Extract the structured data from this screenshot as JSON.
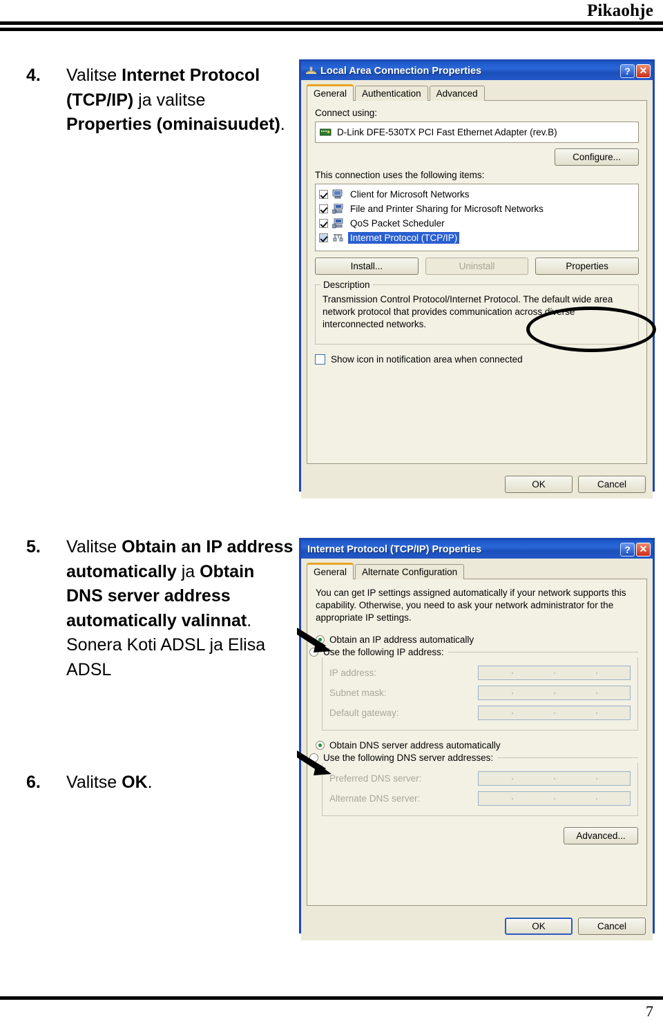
{
  "page": {
    "header_title": "Pikaohje",
    "page_number": "7"
  },
  "steps": [
    {
      "number": "4.",
      "parts": [
        {
          "text": "Valitse ",
          "bold": false
        },
        {
          "text": "Internet Protocol (TCP/IP)",
          "bold": true
        },
        {
          "text": " ja valitse ",
          "bold": false
        },
        {
          "text": "Properties (ominaisuudet)",
          "bold": true
        },
        {
          "text": ".",
          "bold": false
        }
      ],
      "plain": "Valitse Internet Protocol (TCP/IP) ja valitse Properties (ominaisuudet)."
    },
    {
      "number": "5.",
      "parts": [
        {
          "text": "Valitse ",
          "bold": false
        },
        {
          "text": "Obtain an IP address automatically",
          "bold": true
        },
        {
          "text": " ja ",
          "bold": false
        },
        {
          "text": "Obtain DNS server address automatically valinnat",
          "bold": true
        },
        {
          "text": ".",
          "bold": false
        }
      ],
      "note": "Sonera Koti ADSL ja Elisa ADSL",
      "plain": "Valitse Obtain an IP address automatically ja Obtain DNS server address automatically valinnat."
    },
    {
      "number": "6.",
      "parts": [
        {
          "text": "Valitse ",
          "bold": false
        },
        {
          "text": "OK",
          "bold": true
        },
        {
          "text": ".",
          "bold": false
        }
      ],
      "plain": "Valitse OK."
    }
  ],
  "dialog_lan": {
    "title": "Local Area Connection Properties",
    "title_icon": "network-connection-icon",
    "help_button": "?",
    "close_button": "✕",
    "tabs": [
      {
        "label": "General",
        "active": true
      },
      {
        "label": "Authentication",
        "active": false
      },
      {
        "label": "Advanced",
        "active": false
      }
    ],
    "connect_using_label": "Connect using:",
    "adapter_name": "D-Link DFE-530TX PCI Fast Ethernet Adapter (rev.B)",
    "configure_button": "Configure...",
    "items_label": "This connection uses the following items:",
    "items": [
      {
        "label": "Client for Microsoft Networks",
        "checked": true,
        "selected": false,
        "icon": "computer-icon"
      },
      {
        "label": "File and Printer Sharing for Microsoft Networks",
        "checked": true,
        "selected": false,
        "icon": "computer-icon"
      },
      {
        "label": "QoS Packet Scheduler",
        "checked": true,
        "selected": false,
        "icon": "computer-icon"
      },
      {
        "label": "Internet Protocol (TCP/IP)",
        "checked": true,
        "selected": true,
        "icon": "protocol-icon"
      }
    ],
    "install_button": "Install...",
    "uninstall_button": "Uninstall",
    "properties_button": "Properties",
    "description_title": "Description",
    "description_text": "Transmission Control Protocol/Internet Protocol. The default wide area network protocol that provides communication across diverse interconnected networks.",
    "show_icon_checkbox": {
      "label": "Show icon in notification area when connected",
      "checked": false
    },
    "ok_button": "OK",
    "cancel_button": "Cancel"
  },
  "dialog_tcpip": {
    "title": "Internet Protocol (TCP/IP) Properties",
    "help_button": "?",
    "close_button": "✕",
    "tabs": [
      {
        "label": "General",
        "active": true
      },
      {
        "label": "Alternate Configuration",
        "active": false
      }
    ],
    "intro_text": "You can get IP settings assigned automatically if your network supports this capability. Otherwise, you need to ask your network administrator for the appropriate IP settings.",
    "ip_auto_radio": {
      "label": "Obtain an IP address automatically",
      "selected": true
    },
    "ip_manual_radio": {
      "label": "Use the following IP address:",
      "selected": false
    },
    "ip_fields": [
      {
        "label": "IP address:",
        "value": ""
      },
      {
        "label": "Subnet mask:",
        "value": ""
      },
      {
        "label": "Default gateway:",
        "value": ""
      }
    ],
    "dns_auto_radio": {
      "label": "Obtain DNS server address automatically",
      "selected": true
    },
    "dns_manual_radio": {
      "label": "Use the following DNS server addresses:",
      "selected": false
    },
    "dns_fields": [
      {
        "label": "Preferred DNS server:",
        "value": ""
      },
      {
        "label": "Alternate DNS server:",
        "value": ""
      }
    ],
    "advanced_button": "Advanced...",
    "ok_button": "OK",
    "cancel_button": "Cancel"
  },
  "annotations": {
    "ellipse_target": "properties-button",
    "arrow_1_target": "ip-auto-radio",
    "arrow_2_target": "dns-auto-radio"
  }
}
